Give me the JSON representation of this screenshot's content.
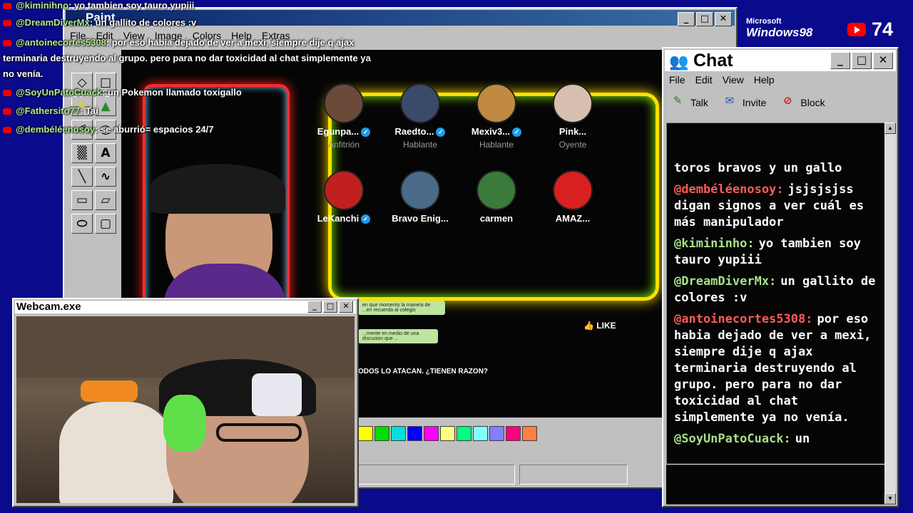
{
  "paint": {
    "title": "Paint",
    "menu": [
      "File",
      "Edit",
      "View",
      "Image",
      "Colors",
      "Help",
      "Extras"
    ],
    "window_buttons": [
      "_",
      "□",
      "✕"
    ],
    "tools": [
      "◇",
      "□",
      "✎",
      "▲",
      "✐",
      "○",
      "▒",
      "A",
      "╲",
      "∿",
      "▭",
      "▱",
      "⬭",
      "▢"
    ],
    "palette": [
      "#ffff00",
      "#00dd00",
      "#00e0e0",
      "#0000ff",
      "#ff00ff",
      "#ffff80",
      "#00ff80",
      "#80ffff",
      "#8080ff",
      "#ff0080",
      "#ff8040"
    ],
    "video": {
      "participants": [
        {
          "name": "Egunpa...",
          "role": "Anfitrión",
          "verified": true,
          "color": "#6b4a3a"
        },
        {
          "name": "Raedto...",
          "role": "Hablante",
          "verified": true,
          "color": "#3a4a6b"
        },
        {
          "name": "Mexiv3...",
          "role": "Hablante",
          "verified": true,
          "color": "#c08a40"
        },
        {
          "name": "Pink...",
          "role": "Oyente",
          "verified": false,
          "color": "#d8c0b0"
        },
        {
          "name": "LeKanchi",
          "role": "",
          "verified": true,
          "color": "#c02020"
        },
        {
          "name": "Bravo Enig...",
          "role": "",
          "verified": false,
          "color": "#4a6a8a"
        },
        {
          "name": "carmen",
          "role": "",
          "verified": false,
          "color": "#3a7a3a"
        },
        {
          "name": "AMAZ...",
          "role": "",
          "verified": false,
          "color": "#d82020"
        }
      ],
      "like_label": "LIKE",
      "caption": "ODOS LO ATACAN. ¿TIENEN RAZON?",
      "bubbles": [
        "en que momento la manera de ...en recuerda al colegio",
        "...mente en medio de una discusion que ..."
      ]
    }
  },
  "overlay_chat": [
    {
      "user": "@kiminihno",
      "text": ": yo tambien soy tauro yupiii"
    },
    {
      "user": "@DreamDiverMx",
      "text": ": un gallito de colores :v"
    },
    {
      "user": "@antoinecortes5308",
      "text": ": por eso habia dejado de ver a mexi, siempre dije q ajax"
    },
    {
      "user": "",
      "text": "terminaria destruyendo al grupo. pero para no dar toxicidad al chat simplemente ya"
    },
    {
      "user": "",
      "text": "no venía."
    },
    {
      "user": "@SoyUnPatoCuack",
      "text": ": un Pokemon llamado toxigallo"
    },
    {
      "user": "@Fathersito77",
      "text": ": Tai"
    },
    {
      "user": "@dembéléenosoy",
      "text": ": se aburrió= espacios 24/7"
    }
  ],
  "webcam": {
    "title": "Webcam.exe",
    "window_buttons": [
      "_",
      "□",
      "✕"
    ]
  },
  "chat_window": {
    "title": "Chat",
    "menu": [
      "File",
      "Edit",
      "View",
      "Help"
    ],
    "window_buttons": [
      "_",
      "□",
      "✕"
    ],
    "toolbar": [
      {
        "label": "Talk",
        "icon": "talk-icon",
        "color": "#2a7a2a"
      },
      {
        "label": "Invite",
        "icon": "invite-icon",
        "color": "#2a5aa0"
      },
      {
        "label": "Block",
        "icon": "block-icon",
        "color": "#d02020"
      }
    ],
    "messages": [
      {
        "user": "",
        "user_color": "#ff5a5a",
        "text": "toros bravos y un gallo"
      },
      {
        "user": "@dembéléenosoy:",
        "user_color": "#ff5a5a",
        "text": "jsjsjsjss digan signos a ver cuál es más manipulador"
      },
      {
        "user": "@kimininho:",
        "user_color": "#a6e08a",
        "text": "yo tambien soy tauro yupiii"
      },
      {
        "user": "@DreamDiverMx:",
        "user_color": "#a6e08a",
        "text": "un gallito de colores :v"
      },
      {
        "user": "@antoinecortes5308:",
        "user_color": "#ff5a5a",
        "text": "por eso habia dejado de ver a mexi, siempre dije q ajax terminaria destruyendo al grupo. pero para no dar toxicidad al chat simplemente ya no venía."
      },
      {
        "user": "@SoyUnPatoCuack:",
        "user_color": "#a6e08a",
        "text": "un"
      }
    ]
  },
  "brand": {
    "line1": "Microsoft",
    "line2": "Windows98"
  },
  "viewers": {
    "count": "74",
    "platform_icon": "youtube-icon"
  }
}
